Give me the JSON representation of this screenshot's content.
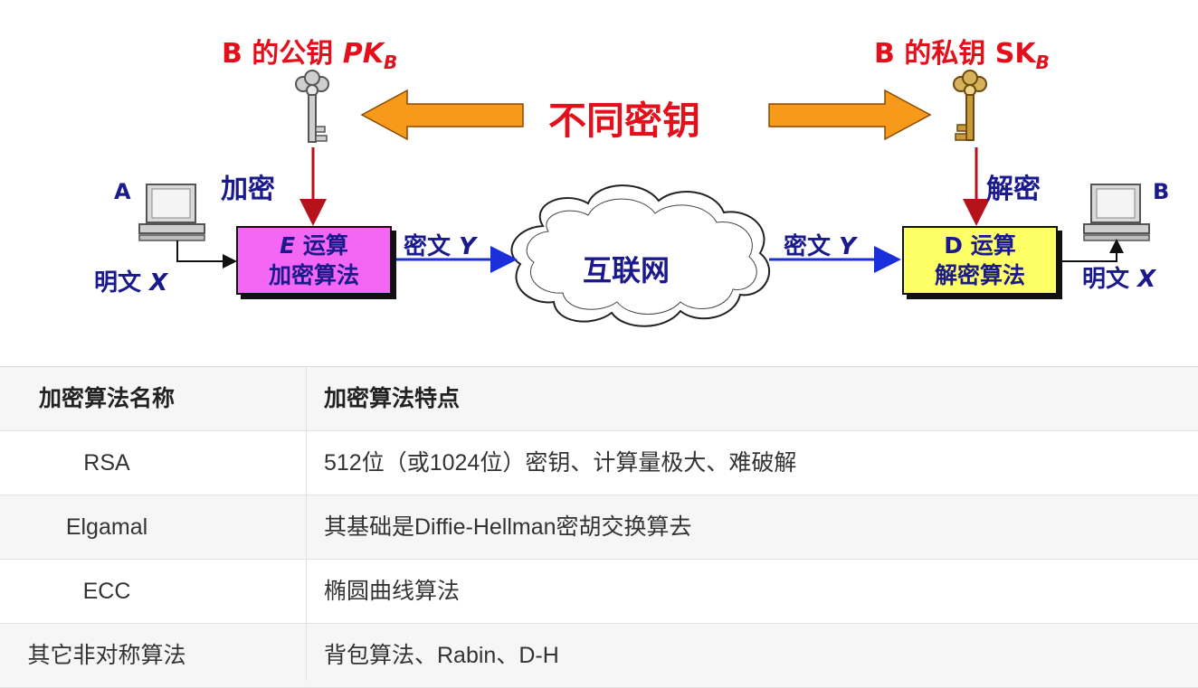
{
  "diagram": {
    "public_key_label": {
      "prefix": "B 的公钥 ",
      "key": "PK",
      "sub": "B"
    },
    "private_key_label": {
      "prefix": "B 的私钥 ",
      "key": "SK",
      "sub": "B"
    },
    "different_keys": "不同密钥",
    "encrypt_label": "加密",
    "decrypt_label": "解密",
    "sender": "A",
    "receiver": "B",
    "plaintext_left": {
      "text": "明文 ",
      "var": "X"
    },
    "plaintext_right": {
      "text": "明文 ",
      "var": "X"
    },
    "ciphertext_left": {
      "text": "密文 ",
      "var": "Y"
    },
    "ciphertext_right": {
      "text": "密文 ",
      "var": "Y"
    },
    "encrypt_box": {
      "line1_var": "E",
      "line1": " 运算",
      "line2": "加密算法"
    },
    "decrypt_box": {
      "line1": "D 运算",
      "line2": "解密算法"
    },
    "network": "互联网",
    "colors": {
      "encrypt_box": "#f466f4",
      "decrypt_box": "#ffff66",
      "arrow_orange": "#f79a1c",
      "arrow_red": "#b5121b",
      "arrow_blue": "#1a2fd9"
    }
  },
  "table": {
    "headers": [
      "加密算法名称",
      "加密算法特点"
    ],
    "rows": [
      [
        "RSA",
        "512位（或1024位）密钥、计算量极大、难破解"
      ],
      [
        "Elgamal",
        "其基础是Diffie-Hellman密胡交换算去"
      ],
      [
        "ECC",
        "椭圆曲线算法"
      ],
      [
        "其它非对称算法",
        "背包算法、Rabin、D-H"
      ]
    ]
  }
}
